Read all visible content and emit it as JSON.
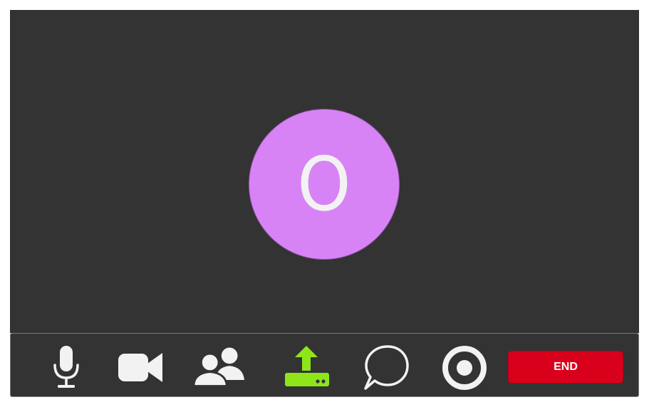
{
  "participant": {
    "initial": "O",
    "avatar_color": "#d883f5"
  },
  "toolbar": {
    "buttons": [
      {
        "name": "microphone",
        "icon": "microphone-icon",
        "color": "#f2f2f2"
      },
      {
        "name": "camera",
        "icon": "video-camera-icon",
        "color": "#f2f2f2"
      },
      {
        "name": "participants",
        "icon": "participants-icon",
        "color": "#f2f2f2"
      },
      {
        "name": "share-screen",
        "icon": "upload-share-icon",
        "color": "#8ee61a"
      },
      {
        "name": "chat",
        "icon": "chat-bubble-icon",
        "color": "#f2f2f2"
      },
      {
        "name": "record",
        "icon": "record-icon",
        "color": "#f2f2f2"
      }
    ],
    "end_label": "END",
    "end_color": "#d9001b"
  }
}
